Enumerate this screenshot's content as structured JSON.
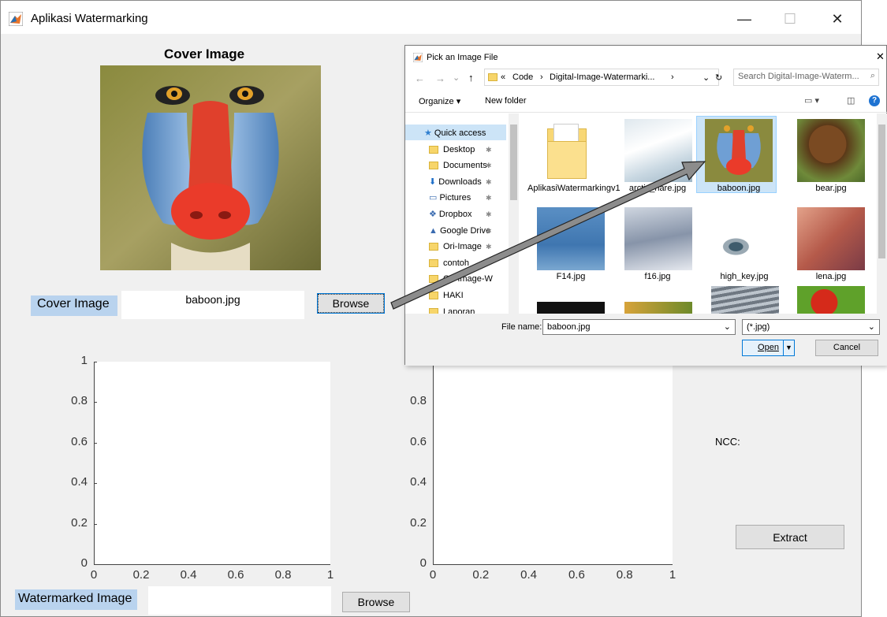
{
  "app": {
    "title": "Aplikasi Watermarking",
    "minimize": "—",
    "maximize": "☐",
    "close": "✕"
  },
  "cover": {
    "heading": "Cover Image",
    "label": "Cover Image",
    "filename": "baboon.jpg",
    "browse": "Browse"
  },
  "watermarked": {
    "label": "Watermarked Image",
    "filename": "",
    "browse": "Browse"
  },
  "ncc_label": "NCC:",
  "extract_button": "Extract",
  "axes_left": {
    "x_ticks": [
      "0",
      "0.2",
      "0.4",
      "0.6",
      "0.8",
      "1"
    ],
    "y_ticks": [
      "0",
      "0.2",
      "0.4",
      "0.6",
      "0.8",
      "1"
    ]
  },
  "axes_right": {
    "x_ticks": [
      "0",
      "0.2",
      "0.4",
      "0.6",
      "0.8",
      "1"
    ],
    "y_ticks": [
      "0",
      "0.2",
      "0.4",
      "0.6",
      "0.8"
    ]
  },
  "dialog": {
    "title": "Pick an Image File",
    "close": "✕",
    "breadcrumb": [
      "«",
      "Code",
      "›",
      "Digital-Image-Watermarki...",
      "›"
    ],
    "search_placeholder": "Search Digital-Image-Waterm...",
    "organize": "Organize ▾",
    "new_folder": "New folder",
    "nav": [
      "Quick access",
      "Desktop",
      "Documents",
      "Downloads",
      "Pictures",
      "Dropbox",
      "Google Drive",
      "Ori-Image",
      "contoh",
      "Ori-Image-W",
      "HAKI",
      "Laporan"
    ],
    "files": [
      "AplikasiWatermarkingv1",
      "arctic_hare.jpg",
      "baboon.jpg",
      "bear.jpg",
      "F14.jpg",
      "f16.jpg",
      "high_key.jpg",
      "lena.jpg"
    ],
    "filename_label": "File name:",
    "filename_value": "baboon.jpg",
    "filter": "(*.jpg)",
    "open": "Open",
    "cancel": "Cancel"
  },
  "colors": {
    "selection": "#cce4f7",
    "label_bg": "#b9d3ee",
    "arrow": "#8c8c8c"
  }
}
